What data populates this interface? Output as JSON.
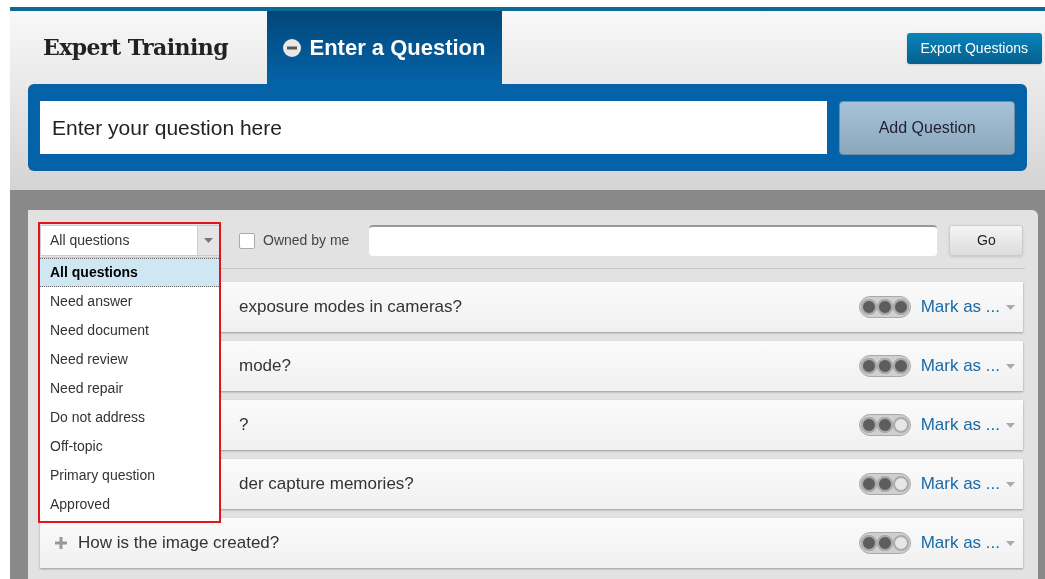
{
  "header": {
    "title": "Expert Training",
    "tab": {
      "label": "Enter a Question",
      "selected": true
    },
    "export_button": "Export Questions"
  },
  "question_entry": {
    "placeholder": "Enter your question here",
    "button": "Add Question"
  },
  "filter": {
    "select_value": "All questions",
    "owned_by_me": {
      "label": "Owned by me",
      "checked": false
    },
    "go_button": "Go"
  },
  "dropdown": {
    "options": [
      {
        "label": "All questions",
        "selected": true
      },
      {
        "label": "Need answer",
        "selected": false
      },
      {
        "label": "Need document",
        "selected": false
      },
      {
        "label": "Need review",
        "selected": false
      },
      {
        "label": "Need repair",
        "selected": false
      },
      {
        "label": "Do not address",
        "selected": false
      },
      {
        "label": "Off-topic",
        "selected": false
      },
      {
        "label": "Primary question",
        "selected": false
      },
      {
        "label": "Approved",
        "selected": false
      }
    ]
  },
  "questions": [
    {
      "text": "exposure modes in cameras?",
      "partly_hidden": true,
      "level": 1,
      "action": "Mark as ..."
    },
    {
      "text": "mode?",
      "partly_hidden": true,
      "level": 1,
      "action": "Mark as ..."
    },
    {
      "text": "?",
      "partly_hidden": true,
      "level": 0.667,
      "action": "Mark as ..."
    },
    {
      "text": "der capture memories?",
      "partly_hidden": true,
      "level": 0.667,
      "action": "Mark as ..."
    },
    {
      "text": "How is the image created?",
      "partly_hidden": false,
      "level": 0.667,
      "action": "Mark as ..."
    }
  ]
}
